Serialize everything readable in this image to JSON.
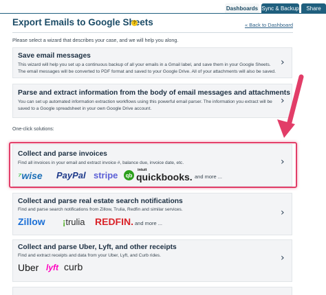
{
  "tabs": [
    {
      "label": "Dashboards",
      "active": true
    },
    {
      "label": "Sync & Backup",
      "active": false
    },
    {
      "label": "Share",
      "active": false
    }
  ],
  "header": {
    "title": "Export Emails to Google Sheets",
    "help_icon": "?",
    "back_link": "« Back to Dashboard"
  },
  "intro": "Please select a wizard that describes your case, and we will help you along.",
  "cards": [
    {
      "title": "Save email messages",
      "description": "This wizard will help you set up a continuous backup of all your emails in a Gmail label, and save them in your Google Sheets. The email messages will be converted to PDF format and saved to your Google Drive. All of your attachments will also be saved."
    },
    {
      "title": "Parse and extract information from the body of email messages and attachments",
      "description": "You can set up automated information extraction workflows using this powerful email parser. The information you extract will be saved to a Google spreadsheet in your own Google Drive account."
    }
  ],
  "one_click_label": "One-click solutions:",
  "solutions": [
    {
      "title": "Collect and parse invoices",
      "description": "Find all invoices in your email and extract invoice #, balance due, invoice date, etc.",
      "logos": [
        "wise",
        "PayPal",
        "stripe",
        "intuit",
        "quickbooks."
      ],
      "more": "and more ..."
    },
    {
      "title": "Collect and parse real estate search notifications",
      "description": "Find and parse search notifications from Zillow, Trulia, Redfin and similar services.",
      "logos": [
        "Zillow",
        "trulia",
        "REDFIN."
      ],
      "more": "and more ..."
    },
    {
      "title": "Collect and parse Uber, Lyft, and other receipts",
      "description": "Find and extract receipts and data from your Uber, Lyft, and Curb rides.",
      "logos": [
        "Uber",
        "lyft",
        "curb"
      ]
    }
  ],
  "colors": {
    "tab_bg": "#1f5f7e",
    "title": "#1b4b66",
    "card_bg": "#f3f4f6",
    "highlight": "#e23d68",
    "arrow": "#e23d68"
  }
}
